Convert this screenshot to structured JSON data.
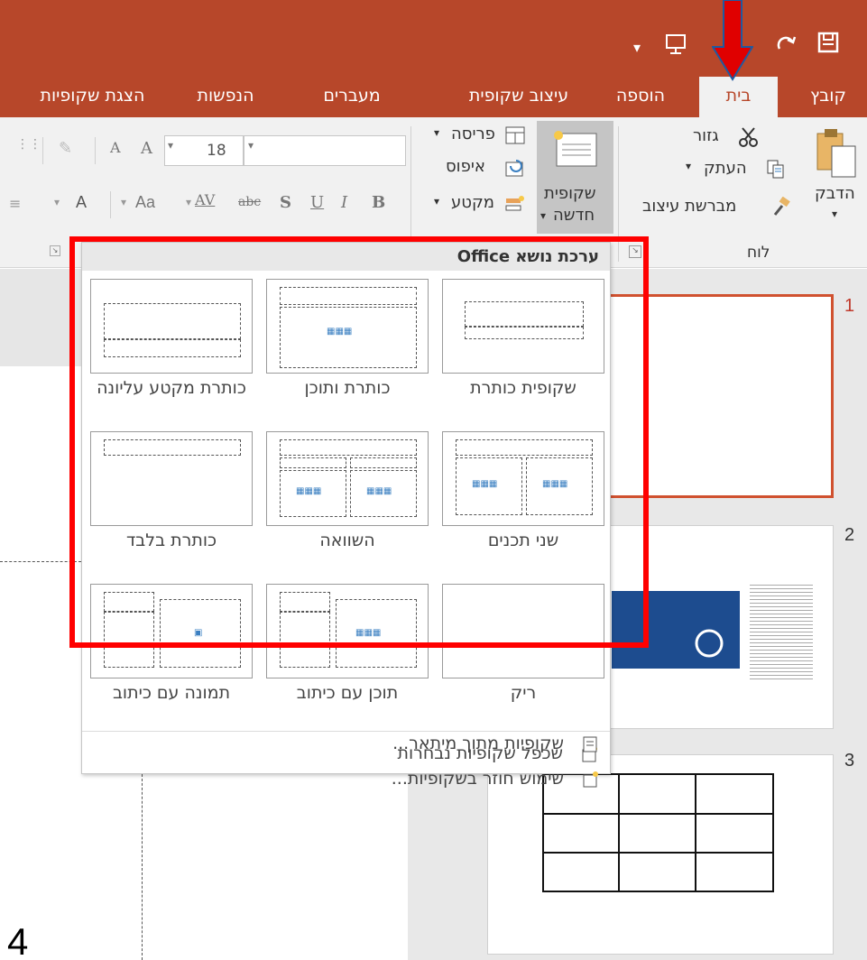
{
  "title_bar": {
    "customize_icon": "customize-qat-icon",
    "present_icon": "present-from-start-icon",
    "undo_icon": "undo-icon",
    "redo_icon": "redo-icon",
    "save_icon": "save-icon"
  },
  "tabs": [
    {
      "label": "קובץ"
    },
    {
      "label": "בית"
    },
    {
      "label": "הוספה"
    },
    {
      "label": "עיצוב שקופית"
    },
    {
      "label": "מעברים"
    },
    {
      "label": "הנפשות"
    },
    {
      "label": "הצגת שקופיות"
    }
  ],
  "ribbon": {
    "paste": "הדבק",
    "cut": "גזור",
    "copy": "העתק",
    "format_painter": "מברשת עיצוב",
    "clipboard_group": "לוח",
    "new_slide_line1": "שקופית",
    "new_slide_line2": "חדשה",
    "layout": "פריסה",
    "reset": "איפוס",
    "section": "מקטע",
    "font_size": "18",
    "font_grow": "A",
    "font_shrink": "A",
    "format_letters": [
      "B",
      "I",
      "U",
      "S",
      "abc",
      "AV",
      "Aa",
      "A"
    ]
  },
  "gallery": {
    "header": "ערכת נושא Office",
    "layouts": [
      {
        "name": "שקופית כותרת"
      },
      {
        "name": "כותרת ותוכן"
      },
      {
        "name": "כותרת מקטע עליונה"
      },
      {
        "name": "שני תכנים"
      },
      {
        "name": "השוואה"
      },
      {
        "name": "כותרת בלבד"
      },
      {
        "name": "ריק"
      },
      {
        "name": "תוכן עם כיתוב"
      },
      {
        "name": "תמונה עם כיתוב"
      }
    ],
    "menu": [
      {
        "label": "שכפל שקופיות נבחרות"
      },
      {
        "label": "שקופיות מתוך מיתאר..."
      },
      {
        "label": "שימוש חוזר בשקופיות..."
      }
    ]
  },
  "thumbnails": [
    {
      "number": "1"
    },
    {
      "number": "2"
    },
    {
      "number": "3"
    }
  ],
  "page_number": "4",
  "colors": {
    "accent": "#b7472a",
    "highlight": "#ff0000"
  }
}
